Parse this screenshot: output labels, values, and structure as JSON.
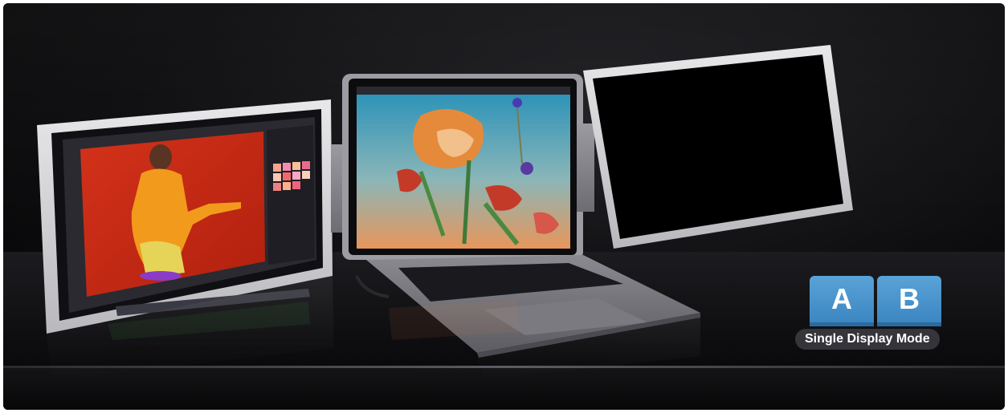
{
  "mode_badge": {
    "left_label": "A",
    "right_label": "B",
    "caption": "Single Display Mode",
    "accent_color": "#4a95cf"
  },
  "scene": {
    "left_screen": "photo-editor-app",
    "center_screen": "flower-artwork",
    "right_screen": "blank-display"
  }
}
